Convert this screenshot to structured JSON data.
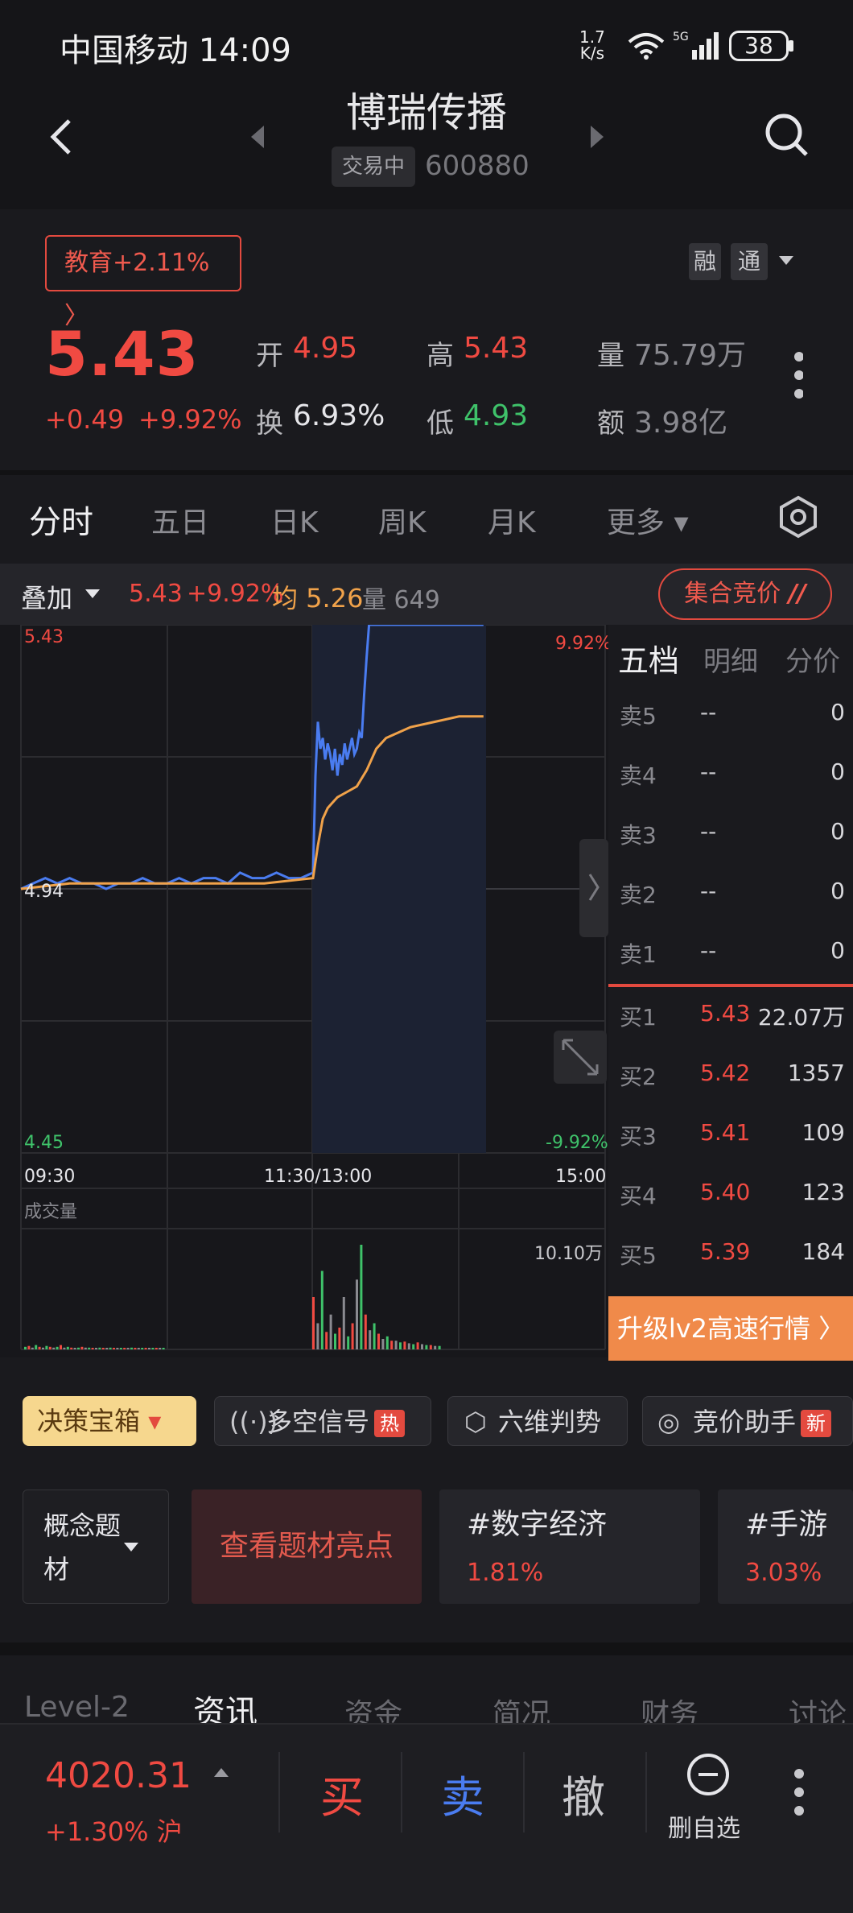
{
  "status_bar": {
    "carrier": "中国移动",
    "time": "14:09",
    "net_speed_value": "1.7",
    "net_speed_unit": "K/s",
    "network": "5G",
    "battery": "38"
  },
  "header": {
    "title": "博瑞传播",
    "badge": "交易中",
    "code": "600880"
  },
  "quote": {
    "sector": "教育+2.11%",
    "rong": "融",
    "tong": "通",
    "price": "5.43",
    "change": "+0.49",
    "change_pct": "+9.92%",
    "open_label": "开",
    "open": "4.95",
    "high_label": "高",
    "high": "5.43",
    "vol_label": "量",
    "vol": "75.79万",
    "turnover_label": "换",
    "turnover": "6.93%",
    "low_label": "低",
    "low": "4.93",
    "amount_label": "额",
    "amount": "3.98亿",
    "colors": {
      "up": "#f04a42",
      "down": "#3fc26a"
    }
  },
  "tabs": {
    "items": [
      "分时",
      "五日",
      "日K",
      "周K",
      "月K",
      "更多"
    ],
    "active": "分时"
  },
  "overlay_bar": {
    "label": "叠加",
    "price": "5.43",
    "pct": "+9.92%",
    "avg": "均 5.26",
    "vol": "量 649",
    "auction": "集合竞价"
  },
  "chart_data": {
    "type": "line",
    "title": "",
    "y_top": "5.43",
    "y_mid": "4.94",
    "y_bottom": "4.45",
    "pct_top": "9.92%",
    "pct_bottom": "-9.92%",
    "x_ticks": [
      "09:30",
      "11:30/13:00",
      "15:00"
    ],
    "ylim": [
      4.45,
      5.43
    ],
    "grid": true,
    "series": [
      {
        "name": "",
        "color": "#4a7cf0",
        "x": [
          0,
          5,
          10,
          15,
          20,
          25,
          30,
          35,
          40,
          45,
          50,
          55,
          60,
          65,
          70,
          75,
          80,
          85,
          90,
          95,
          100,
          105,
          110,
          115,
          120,
          121,
          122,
          123,
          124,
          125,
          126,
          127,
          128,
          129,
          130,
          131,
          132,
          133,
          134,
          135,
          136,
          137,
          138,
          139,
          140,
          141,
          142,
          143,
          144,
          145,
          150,
          155,
          160,
          165,
          170,
          175,
          180,
          185,
          190
        ],
        "y": [
          4.94,
          4.95,
          4.96,
          4.95,
          4.96,
          4.95,
          4.95,
          4.94,
          4.95,
          4.95,
          4.96,
          4.95,
          4.95,
          4.96,
          4.95,
          4.96,
          4.96,
          4.95,
          4.97,
          4.96,
          4.96,
          4.97,
          4.96,
          4.96,
          4.97,
          5.15,
          5.25,
          5.2,
          5.22,
          5.18,
          5.21,
          5.19,
          5.16,
          5.2,
          5.15,
          5.19,
          5.17,
          5.21,
          5.18,
          5.2,
          5.22,
          5.19,
          5.2,
          5.23,
          5.22,
          5.3,
          5.37,
          5.43,
          5.43,
          5.43,
          5.43,
          5.43,
          5.43,
          5.43,
          5.43,
          5.43,
          5.43,
          5.43,
          5.43
        ]
      },
      {
        "name": "",
        "color": "#f0a24a",
        "x": [
          0,
          20,
          40,
          60,
          80,
          100,
          120,
          122,
          124,
          126,
          128,
          130,
          134,
          138,
          142,
          146,
          150,
          160,
          170,
          180,
          190
        ],
        "y": [
          4.94,
          4.95,
          4.95,
          4.95,
          4.95,
          4.95,
          4.96,
          5.02,
          5.07,
          5.09,
          5.1,
          5.11,
          5.12,
          5.13,
          5.16,
          5.2,
          5.22,
          5.24,
          5.25,
          5.26,
          5.26
        ]
      }
    ],
    "volume": {
      "label": "成交量",
      "max_label": "10.10万"
    }
  },
  "order_book": {
    "tabs": [
      "五档",
      "明细",
      "分价"
    ],
    "sells": [
      {
        "label": "卖5",
        "price": "--",
        "vol": "0"
      },
      {
        "label": "卖4",
        "price": "--",
        "vol": "0"
      },
      {
        "label": "卖3",
        "price": "--",
        "vol": "0"
      },
      {
        "label": "卖2",
        "price": "--",
        "vol": "0"
      },
      {
        "label": "卖1",
        "price": "--",
        "vol": "0"
      }
    ],
    "buys": [
      {
        "label": "买1",
        "price": "5.43",
        "vol": "22.07万"
      },
      {
        "label": "买2",
        "price": "5.42",
        "vol": "1357"
      },
      {
        "label": "买3",
        "price": "5.41",
        "vol": "109"
      },
      {
        "label": "买4",
        "price": "5.40",
        "vol": "123"
      },
      {
        "label": "买5",
        "price": "5.39",
        "vol": "184"
      }
    ],
    "upgrade": "升级lv2高速行情 〉"
  },
  "chips": {
    "decision": "决策宝箱",
    "signal": "多空信号",
    "signal_tag": "热",
    "six": "六维判势",
    "bid": "竞价助手",
    "bid_tag": "新"
  },
  "concept": {
    "label": "概念题材",
    "view": "查看题材亮点",
    "themes": [
      {
        "name": "#数字经济",
        "pct": "1.81%"
      },
      {
        "name": "#手游",
        "pct": "3.03%"
      }
    ]
  },
  "info_tabs": [
    "Level-2",
    "资讯",
    "资金",
    "简况",
    "财务",
    "讨论"
  ],
  "bottom": {
    "index": "4020.31",
    "index_chg": "+1.30%",
    "market": "沪",
    "buy": "买",
    "sell": "卖",
    "cancel": "撤",
    "delete": "删自选"
  }
}
